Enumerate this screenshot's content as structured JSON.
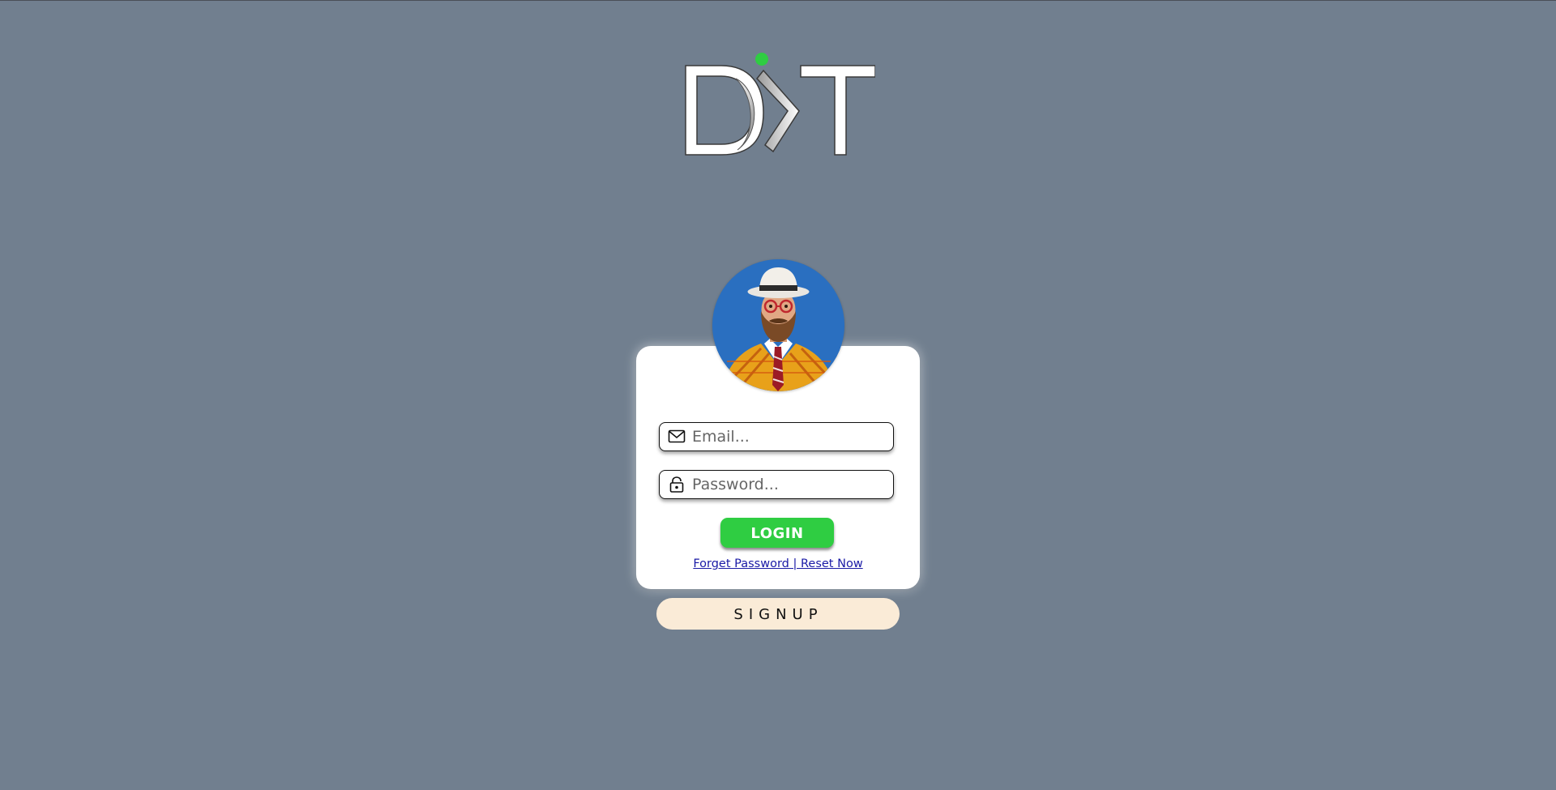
{
  "brand": {
    "logo_text": "DKT",
    "logo_icon": "dkt-logo",
    "dot_color": "#2fcd42"
  },
  "avatar": {
    "icon": "user-avatar-illustration",
    "bg_color": "#2a6fc0"
  },
  "form": {
    "email": {
      "placeholder": "Email...",
      "value": "",
      "icon": "envelope-icon"
    },
    "password": {
      "placeholder": "Password...",
      "value": "",
      "icon": "lock-icon"
    },
    "login_label": "LOGIN",
    "login_color": "#2fcd42",
    "reset_text": "Forget Password | Reset Now"
  },
  "signup": {
    "label": "SIGNUP",
    "bg_color": "#faebd7"
  },
  "page": {
    "background": "#717f8f"
  }
}
